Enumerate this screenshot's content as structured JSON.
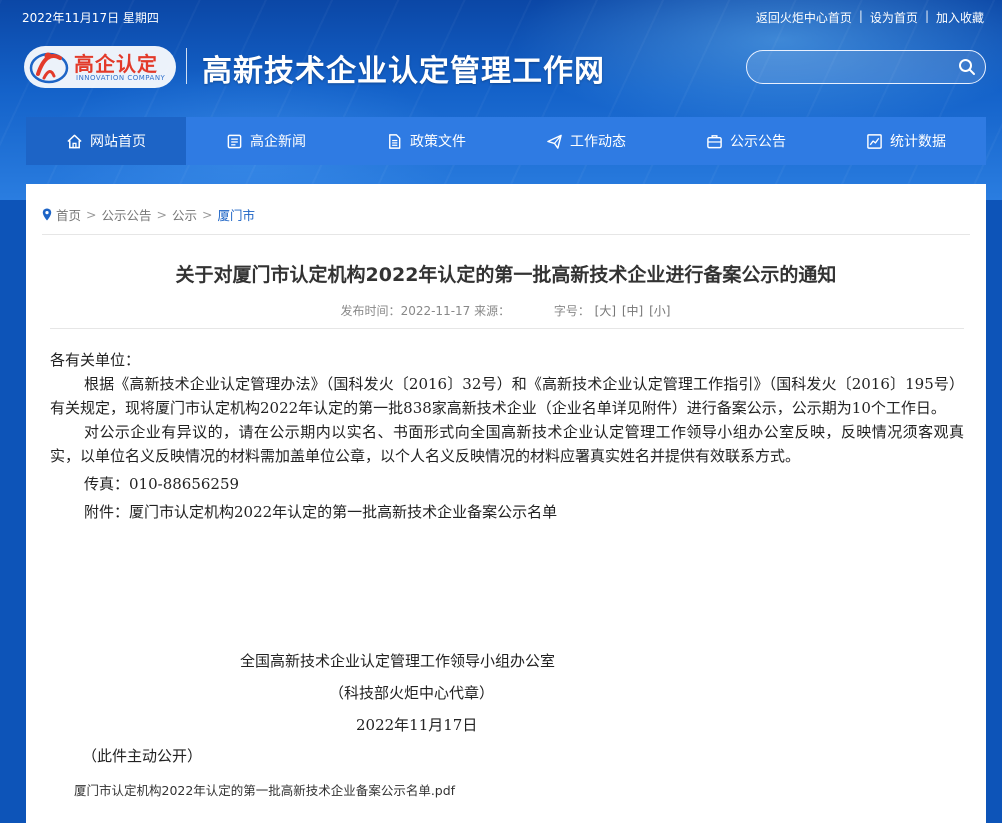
{
  "topbar": {
    "date": "2022年11月17日 星期四",
    "links": [
      "返回火炬中心首页",
      "设为首页",
      "加入收藏"
    ],
    "separator": "|"
  },
  "logo": {
    "cn": "高企认定",
    "en": "INNOVATION COMPANY"
  },
  "site_title": "高新技术企业认定管理工作网",
  "search": {
    "placeholder": "",
    "icon": "search-icon"
  },
  "nav": {
    "items": [
      {
        "label": "网站首页",
        "icon": "home-icon"
      },
      {
        "label": "高企新闻",
        "icon": "news-icon"
      },
      {
        "label": "政策文件",
        "icon": "document-icon"
      },
      {
        "label": "工作动态",
        "icon": "paper-plane-icon"
      },
      {
        "label": "公示公告",
        "icon": "briefcase-icon"
      },
      {
        "label": "统计数据",
        "icon": "chart-icon"
      }
    ],
    "active_index": 0
  },
  "breadcrumb": {
    "items": [
      "首页",
      "公示公告",
      "公示",
      "厦门市"
    ],
    "separator": ">"
  },
  "article": {
    "title": "关于对厦门市认定机构2022年认定的第一批高新技术企业进行备案公示的通知",
    "meta_time_label": "发布时间：",
    "meta_time": "2022-11-17",
    "meta_source_label": "来源：",
    "meta_size_label": "字号：",
    "size_options": [
      "[大]",
      "[中]",
      "[小]"
    ],
    "salutation": "各有关单位：",
    "paragraph1": "根据《高新技术企业认定管理办法》（国科发火〔2016〕32号）和《高新技术企业认定管理工作指引》（国科发火〔2016〕195号）有关规定，现将厦门市认定机构2022年认定的第一批838家高新技术企业（企业名单详见附件）进行备案公示，公示期为10个工作日。",
    "paragraph2": "对公示企业有异议的，请在公示期内以实名、书面形式向全国高新技术企业认定管理工作领导小组办公室反映，反映情况须客观真实，以单位名义反映情况的材料需加盖单位公章，以个人名义反映情况的材料应署真实姓名并提供有效联系方式。",
    "fax": "传真：010-88656259",
    "attachment_line": "附件：厦门市认定机构2022年认定的第一批高新技术企业备案公示名单",
    "signature_org": "全国高新技术企业认定管理工作领导小组办公室",
    "signature_proxy": "（科技部火炬中心代章）",
    "signature_date": "2022年11月17日",
    "public_note": "（此件主动公开）",
    "attachment_file": "厦门市认定机构2022年认定的第一批高新技术企业备案公示名单.pdf"
  },
  "colors": {
    "header_blue": "#1462c9",
    "nav_blue": "#2f7be3",
    "nav_active": "#1d64c6",
    "logo_red": "#e33a2a"
  }
}
